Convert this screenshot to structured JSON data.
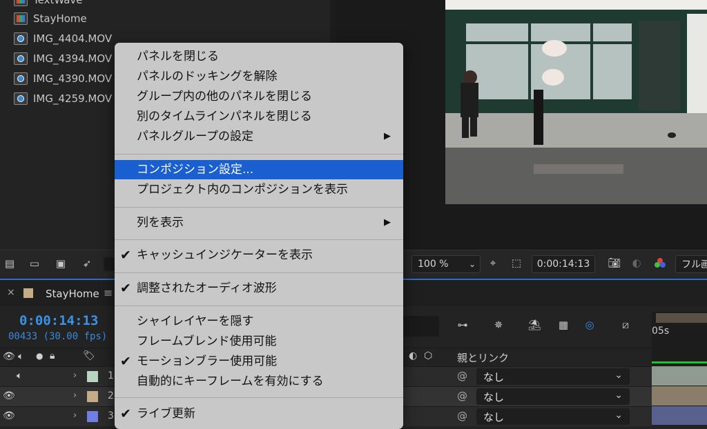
{
  "project": {
    "items": [
      {
        "label": "TextWave",
        "icon": "composition-icon"
      },
      {
        "label": "StayHome",
        "icon": "composition-icon"
      },
      {
        "label": "IMG_4404.MOV",
        "icon": "quicktime-icon"
      },
      {
        "label": "IMG_4394.MOV",
        "icon": "quicktime-icon"
      },
      {
        "label": "IMG_4390.MOV",
        "icon": "quicktime-icon"
      },
      {
        "label": "IMG_4259.MOV",
        "icon": "quicktime-icon"
      }
    ]
  },
  "viewer": {
    "zoom": "100 %",
    "timecode": "0:00:14:13",
    "resolution": "フル画"
  },
  "timeline": {
    "tab_label": "StayHome",
    "current_time": "0:00:14:13",
    "frame_info": "00433 (30.00 fps)",
    "ruler_label": "05s",
    "parent_header": "親とリンク",
    "layers": [
      {
        "num": "1",
        "color": "#b9d4c0",
        "parent": "なし"
      },
      {
        "num": "2",
        "color": "#c4ac88",
        "parent": "なし"
      },
      {
        "num": "3",
        "color": "#6f7ee0",
        "parent": "なし"
      }
    ]
  },
  "context_menu": {
    "items": [
      {
        "label": "パネルを閉じる",
        "checked": false,
        "submenu": false,
        "highlighted": false
      },
      {
        "label": "パネルのドッキングを解除",
        "checked": false,
        "submenu": false,
        "highlighted": false
      },
      {
        "label": "グループ内の他のパネルを閉じる",
        "checked": false,
        "submenu": false,
        "highlighted": false
      },
      {
        "label": "別のタイムラインパネルを閉じる",
        "checked": false,
        "submenu": false,
        "highlighted": false
      },
      {
        "label": "パネルグループの設定",
        "checked": false,
        "submenu": true,
        "highlighted": false
      },
      {
        "label": "コンポジション設定...",
        "checked": false,
        "submenu": false,
        "highlighted": true
      },
      {
        "label": "プロジェクト内のコンポジションを表示",
        "checked": false,
        "submenu": false,
        "highlighted": false
      },
      {
        "label": "列を表示",
        "checked": false,
        "submenu": true,
        "highlighted": false
      },
      {
        "label": "キャッシュインジケーターを表示",
        "checked": true,
        "submenu": false,
        "highlighted": false
      },
      {
        "label": "調整されたオーディオ波形",
        "checked": true,
        "submenu": false,
        "highlighted": false
      },
      {
        "label": "シャイレイヤーを隠す",
        "checked": false,
        "submenu": false,
        "highlighted": false
      },
      {
        "label": "フレームブレンド使用可能",
        "checked": false,
        "submenu": false,
        "highlighted": false
      },
      {
        "label": "モーションブラー使用可能",
        "checked": true,
        "submenu": false,
        "highlighted": false
      },
      {
        "label": "自動的にキーフレームを有効にする",
        "checked": false,
        "submenu": false,
        "highlighted": false
      },
      {
        "label": "ライブ更新",
        "checked": true,
        "submenu": false,
        "highlighted": false
      }
    ],
    "check_glyph": "✔",
    "arrow_glyph": "▶"
  },
  "colors": {
    "accent_blue": "#1a5fd0",
    "timecode_blue": "#3a93e8"
  }
}
